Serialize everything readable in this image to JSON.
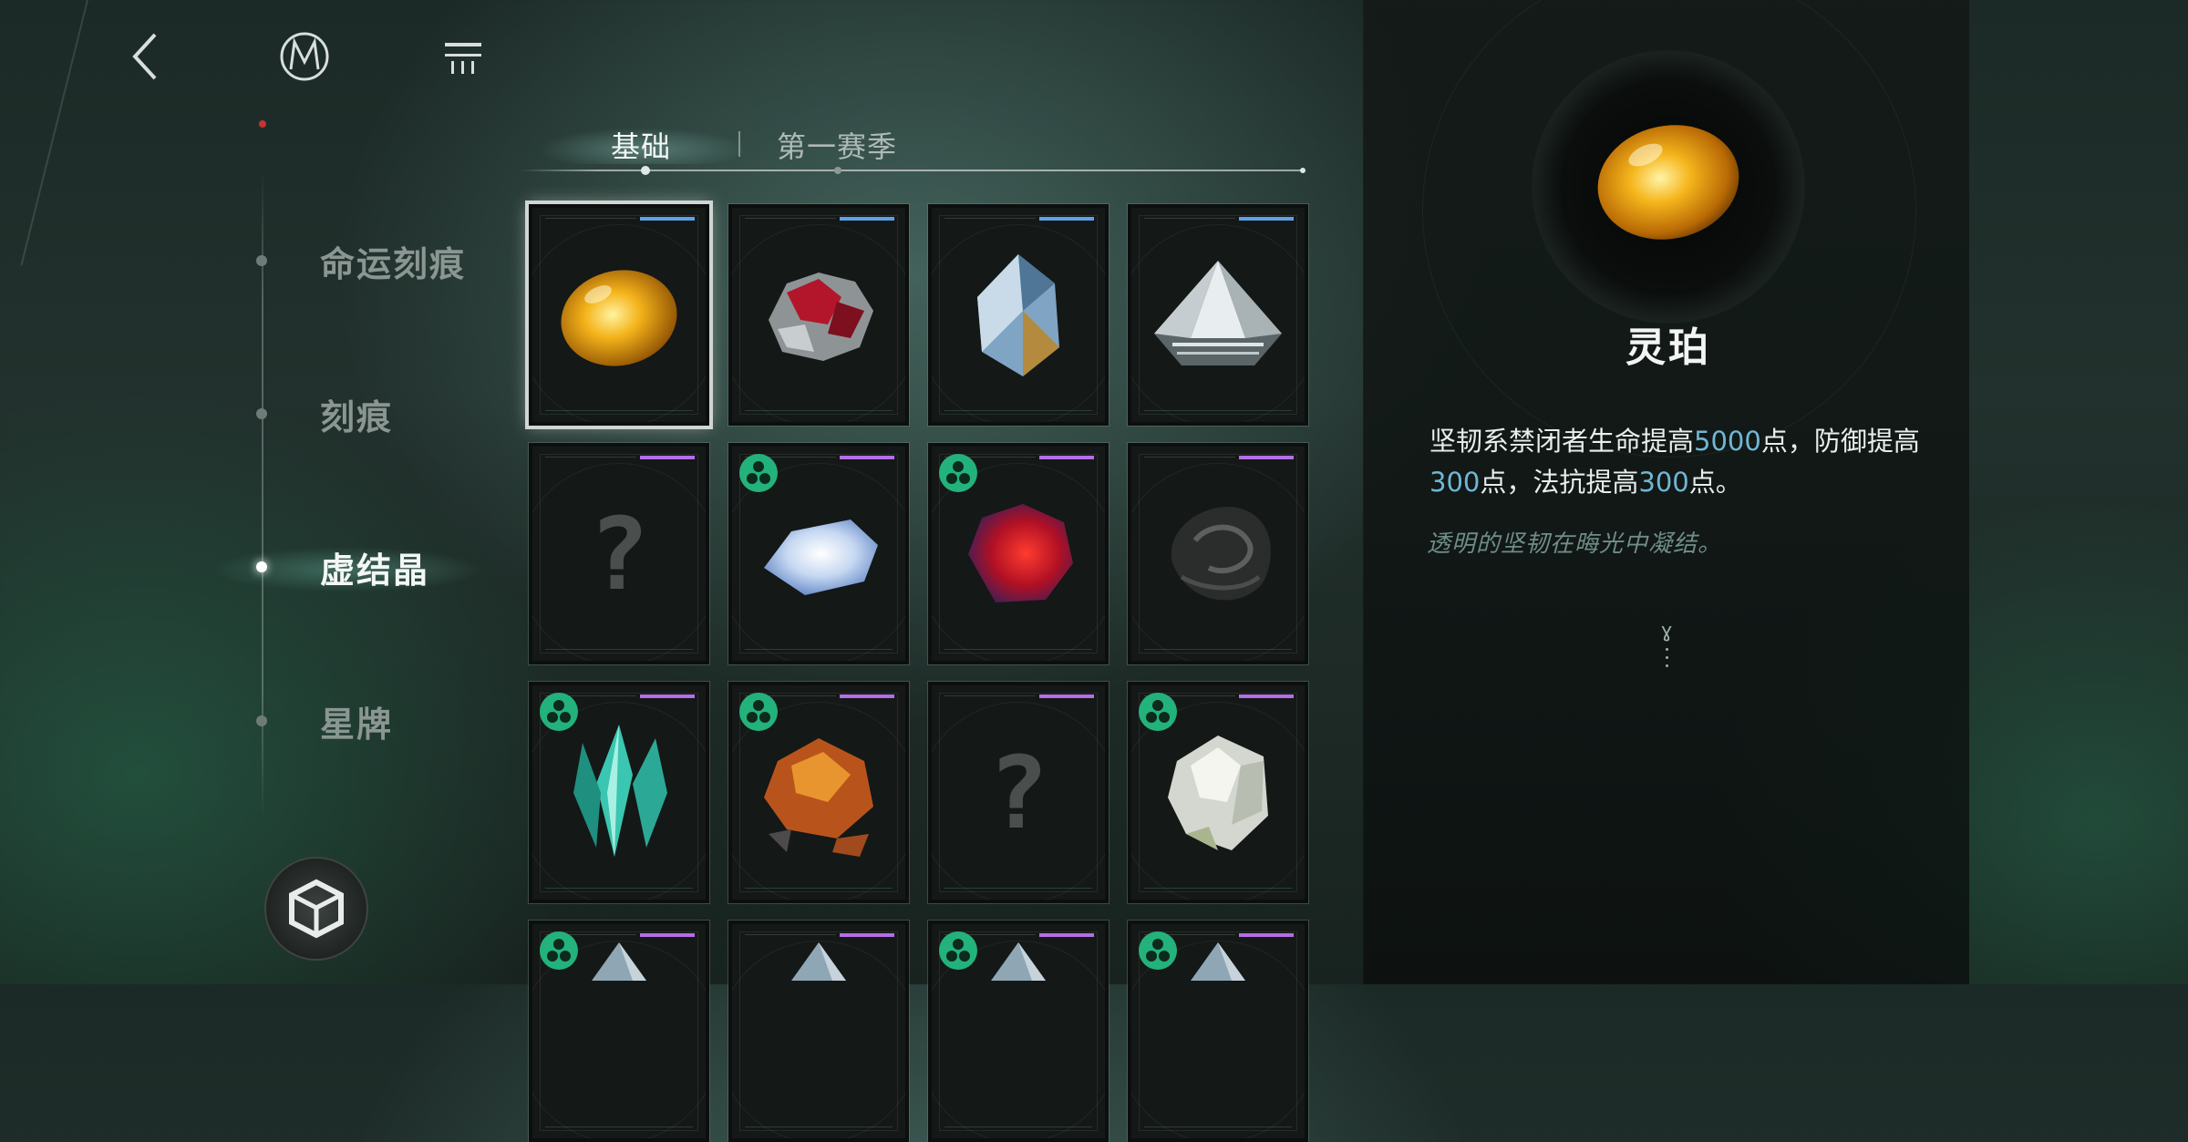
{
  "colors": {
    "accent_number": "#6fb7d4",
    "rarity_blue": "#5ea1e6",
    "rarity_purple": "#b46ee8",
    "badge_green": "#23b27c"
  },
  "header": {
    "back_icon": "chevron-left-icon",
    "logo_icon": "m-logo-icon",
    "menu_icon": "list-menu-icon"
  },
  "nav": {
    "items": [
      {
        "label": "命运刻痕",
        "active": false
      },
      {
        "label": "刻痕",
        "active": false
      },
      {
        "label": "虚结晶",
        "active": true
      },
      {
        "label": "星牌",
        "active": false
      }
    ],
    "cube_icon": "cube-icon"
  },
  "tabs": [
    {
      "label": "基础",
      "active": true
    },
    {
      "label": "第一赛季",
      "active": false
    }
  ],
  "crystals": [
    {
      "name": "amber",
      "rarity": "blue",
      "unknown": false,
      "badge": false,
      "selected": true
    },
    {
      "name": "red-silver-ore",
      "rarity": "blue",
      "unknown": false,
      "badge": false,
      "selected": false
    },
    {
      "name": "blue-gold-shard",
      "rarity": "blue",
      "unknown": false,
      "badge": false,
      "selected": false
    },
    {
      "name": "clear-pyramid",
      "rarity": "blue",
      "unknown": false,
      "badge": false,
      "selected": false
    },
    {
      "name": "unknown",
      "rarity": "purple",
      "unknown": true,
      "badge": false,
      "selected": false
    },
    {
      "name": "moonstone",
      "rarity": "purple",
      "unknown": false,
      "badge": true,
      "selected": false
    },
    {
      "name": "ruby-cluster",
      "rarity": "purple",
      "unknown": false,
      "badge": true,
      "selected": false
    },
    {
      "name": "black-obsidian",
      "rarity": "purple",
      "unknown": false,
      "badge": false,
      "selected": false
    },
    {
      "name": "teal-crystal",
      "rarity": "purple",
      "unknown": false,
      "badge": true,
      "selected": false
    },
    {
      "name": "orange-garnet",
      "rarity": "purple",
      "unknown": false,
      "badge": true,
      "selected": false
    },
    {
      "name": "unknown",
      "rarity": "purple",
      "unknown": true,
      "badge": false,
      "selected": false
    },
    {
      "name": "white-quartz",
      "rarity": "purple",
      "unknown": false,
      "badge": true,
      "selected": false
    },
    {
      "name": "partial-1",
      "rarity": "purple",
      "unknown": false,
      "badge": true,
      "selected": false
    },
    {
      "name": "partial-2",
      "rarity": "purple",
      "unknown": false,
      "badge": false,
      "selected": false
    },
    {
      "name": "partial-3",
      "rarity": "purple",
      "unknown": false,
      "badge": true,
      "selected": false
    },
    {
      "name": "partial-4",
      "rarity": "purple",
      "unknown": false,
      "badge": true,
      "selected": false
    }
  ],
  "detail": {
    "name": "灵珀",
    "desc_p1": "坚韧系禁闭者生命提高",
    "desc_n1": "5000",
    "desc_p2": "点，防御提高",
    "desc_n2": "300",
    "desc_p3": "点，法抗提高",
    "desc_n3": "300",
    "desc_p4": "点。",
    "flavor": "透明的坚韧在晦光中凝结。",
    "marker_symbol": "ɣ"
  }
}
